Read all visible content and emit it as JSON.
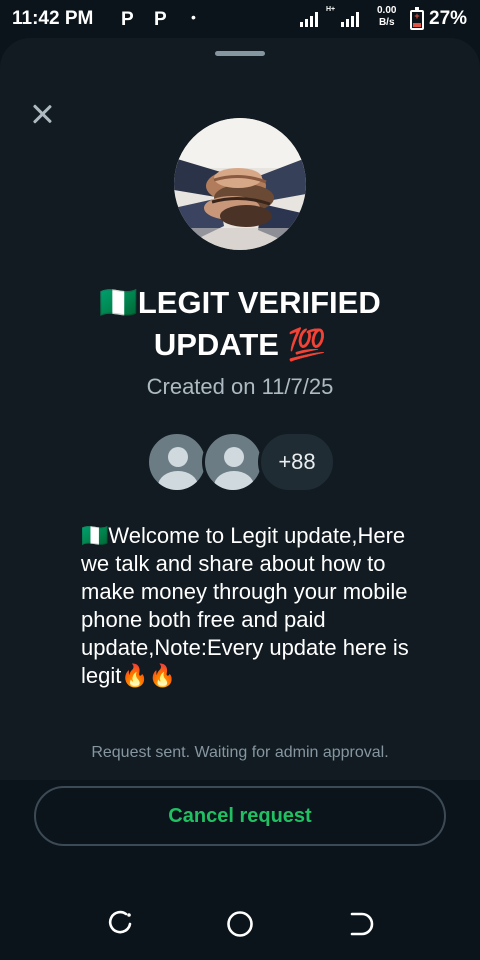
{
  "status_bar": {
    "time": "11:42 PM",
    "notification_icons": [
      "P",
      "P"
    ],
    "dot": "•",
    "network_type": "H+",
    "speed_value": "0.00",
    "speed_unit": "B/s",
    "battery_percent": "27%",
    "battery_level": 0.27,
    "battery_color": "#e05646"
  },
  "sheet": {
    "close_icon": "close-icon",
    "group_title": "🇳🇬LEGIT VERIFIED UPDATE 💯",
    "created": "Created on 11/7/25",
    "member_more_count": "+88",
    "description": "🇳🇬Welcome to Legit update,Here we talk and share about how to make money through your mobile phone both free and paid update,Note:Every update here is legit🔥🔥",
    "request_status": "Request sent. Waiting for admin approval."
  },
  "actions": {
    "cancel_label": "Cancel request",
    "accent_color": "#21c063"
  },
  "nav_bar": {
    "icons": [
      "recents-icon",
      "home-icon",
      "back-icon"
    ]
  }
}
